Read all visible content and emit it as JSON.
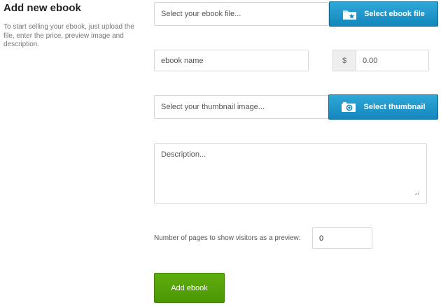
{
  "intro": {
    "title": "Add new ebook",
    "description": "To start selling your ebook, just upload the file, enter the price, preview image and description."
  },
  "ebook_file": {
    "placeholder": "Select your ebook file...",
    "button_label": "Select ebook file",
    "button_icon": "folder-star-icon"
  },
  "ebook_name": {
    "placeholder": "ebook name"
  },
  "price": {
    "currency_symbol": "$",
    "placeholder": "0.00"
  },
  "thumbnail": {
    "placeholder": "Select your thumbnail image...",
    "button_label": "Select thumbnail",
    "button_icon": "camera-icon"
  },
  "description": {
    "placeholder": "Description..."
  },
  "preview_pages": {
    "label": "Number of pages to show visitors as a preview:",
    "value": "0"
  },
  "submit": {
    "label": "Add ebook"
  },
  "colors": {
    "primary_blue": "#1e96cb",
    "submit_green": "#55a308"
  }
}
